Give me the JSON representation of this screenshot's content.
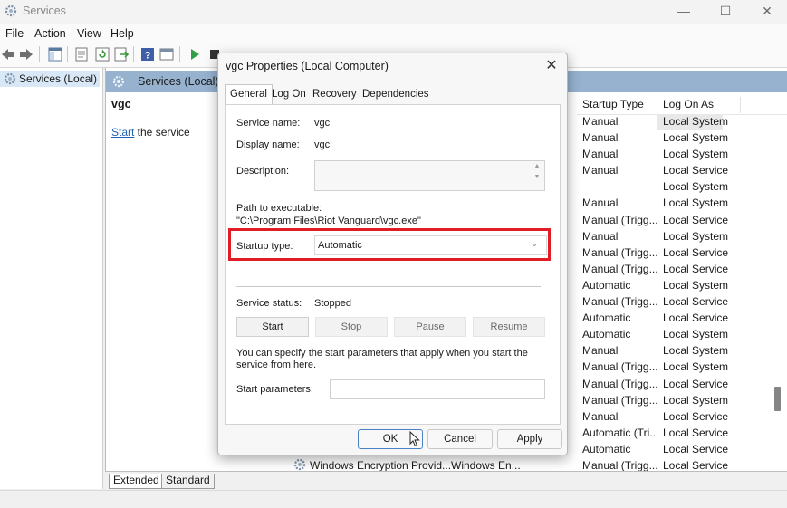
{
  "window": {
    "title": "Services",
    "min_symbol": "—",
    "max_symbol": "☐",
    "close_symbol": "✕"
  },
  "menu": [
    "File",
    "Action",
    "View",
    "Help"
  ],
  "tree": {
    "item": "Services (Local)"
  },
  "pane": {
    "header": "Services (Local)",
    "service_name": "vgc",
    "start_link": "Start",
    "start_suffix": " the service",
    "columns": [
      "Startup Type",
      "Log On As"
    ],
    "rows": [
      {
        "startup": "Manual",
        "logon": "Local System"
      },
      {
        "startup": "Manual",
        "logon": "Local System"
      },
      {
        "startup": "Manual",
        "logon": "Local System"
      },
      {
        "startup": "Manual",
        "logon": "Local Service"
      },
      {
        "startup": "",
        "logon": "Local System"
      },
      {
        "startup": "Manual",
        "logon": "Local System"
      },
      {
        "startup": "Manual (Trigg...",
        "logon": "Local Service"
      },
      {
        "startup": "Manual",
        "logon": "Local System"
      },
      {
        "startup": "Manual (Trigg...",
        "logon": "Local Service"
      },
      {
        "startup": "Manual (Trigg...",
        "logon": "Local Service"
      },
      {
        "startup": "Automatic",
        "logon": "Local System"
      },
      {
        "startup": "Manual (Trigg...",
        "logon": "Local Service"
      },
      {
        "startup": "Automatic",
        "logon": "Local Service"
      },
      {
        "startup": "Automatic",
        "logon": "Local System"
      },
      {
        "startup": "Manual",
        "logon": "Local System"
      },
      {
        "startup": "Manual (Trigg...",
        "logon": "Local System"
      },
      {
        "startup": "Manual (Trigg...",
        "logon": "Local Service"
      },
      {
        "startup": "Manual (Trigg...",
        "logon": "Local System"
      },
      {
        "startup": "Manual",
        "logon": "Local Service"
      },
      {
        "startup": "Automatic (Tri...",
        "logon": "Local Service"
      },
      {
        "startup": "Automatic",
        "logon": "Local Service"
      },
      {
        "startup": "Manual (Trigg...",
        "logon": "Local Service"
      }
    ],
    "bottom_row_name": "Windows Encryption Provid...",
    "bottom_row_desc": "Windows En...",
    "tabs": [
      "Extended",
      "Standard"
    ]
  },
  "dialog": {
    "title": "vgc Properties (Local Computer)",
    "close_symbol": "✕",
    "tabs": [
      "General",
      "Log On",
      "Recovery",
      "Dependencies"
    ],
    "service_name_label": "Service name:",
    "service_name_value": "vgc",
    "display_name_label": "Display name:",
    "display_name_value": "vgc",
    "description_label": "Description:",
    "path_label": "Path to executable:",
    "path_value": "\"C:\\Program Files\\Riot Vanguard\\vgc.exe\"",
    "startup_type_label": "Startup type:",
    "startup_type_value": "Automatic",
    "status_label": "Service status:",
    "status_value": "Stopped",
    "buttons": {
      "start": "Start",
      "stop": "Stop",
      "pause": "Pause",
      "resume": "Resume"
    },
    "hint": "You can specify the start parameters that apply when you start the service from here.",
    "params_label": "Start parameters:",
    "ok": "OK",
    "cancel": "Cancel",
    "apply": "Apply"
  },
  "colors": {
    "highlight": "#e01c24",
    "header": "#96b2cf",
    "link": "#1f64b4"
  }
}
